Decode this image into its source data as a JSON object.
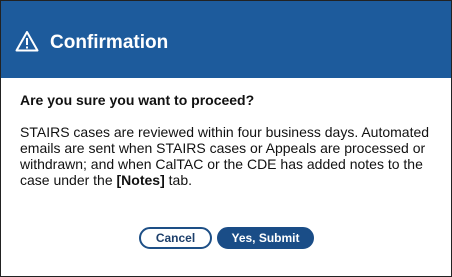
{
  "dialog": {
    "title": "Confirmation",
    "title_icon": "warning-triangle-icon",
    "question": "Are you sure you want to proceed?",
    "message": {
      "line1": "STAIRS cases are reviewed within four business days. Automated",
      "line2": "emails are sent when STAIRS cases or Appeals are processed or",
      "line3": "withdrawn; and when CalTAC or the CDE has added notes to the",
      "line4_before": "case under the ",
      "line4_bold": "[Notes]",
      "line4_after": " tab."
    },
    "buttons": {
      "cancel_label": "Cancel",
      "submit_label": "Yes, Submit"
    }
  },
  "colors": {
    "header_bg": "#1d5b9c",
    "primary_button": "#1a4d87",
    "text": "#111111",
    "border": "#222222"
  }
}
